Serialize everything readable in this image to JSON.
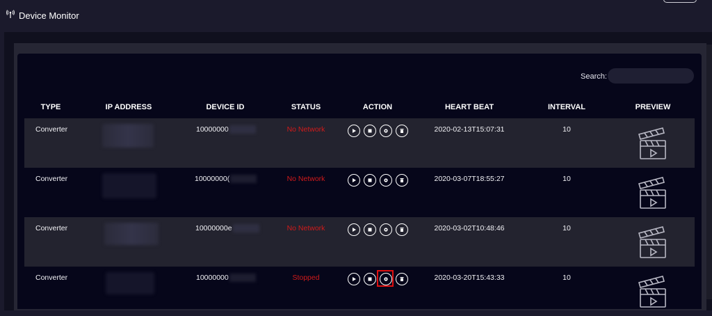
{
  "app": {
    "title": "Device Monitor",
    "title_icon": "antenna-icon"
  },
  "search": {
    "label": "Search:",
    "value": ""
  },
  "table": {
    "columns": [
      "TYPE",
      "IP ADDRESS",
      "DEVICE ID",
      "STATUS",
      "ACTION",
      "HEART BEAT",
      "INTERVAL",
      "PREVIEW"
    ],
    "rows": [
      {
        "type": "Converter",
        "device_id": "10000000",
        "status": "No Network",
        "heart_beat": "2020-02-13T15:07:31",
        "interval": "10"
      },
      {
        "type": "Converter",
        "device_id": "10000000(",
        "status": "No Network",
        "heart_beat": "2020-03-07T18:55:27",
        "interval": "10"
      },
      {
        "type": "Converter",
        "device_id": "10000000e",
        "status": "No Network",
        "heart_beat": "2020-03-02T10:48:46",
        "interval": "10"
      },
      {
        "type": "Converter",
        "device_id": "10000000",
        "status": "Stopped",
        "heart_beat": "2020-03-20T15:43:33",
        "interval": "10"
      }
    ]
  },
  "actions": [
    "play-icon",
    "stop-icon",
    "settings-icon",
    "trash-icon"
  ],
  "colors": {
    "background": "#1b1a2c",
    "card": "#06061a",
    "alt_row": "#23232f",
    "status_error": "#d11a1a",
    "highlight": "#e01010"
  }
}
